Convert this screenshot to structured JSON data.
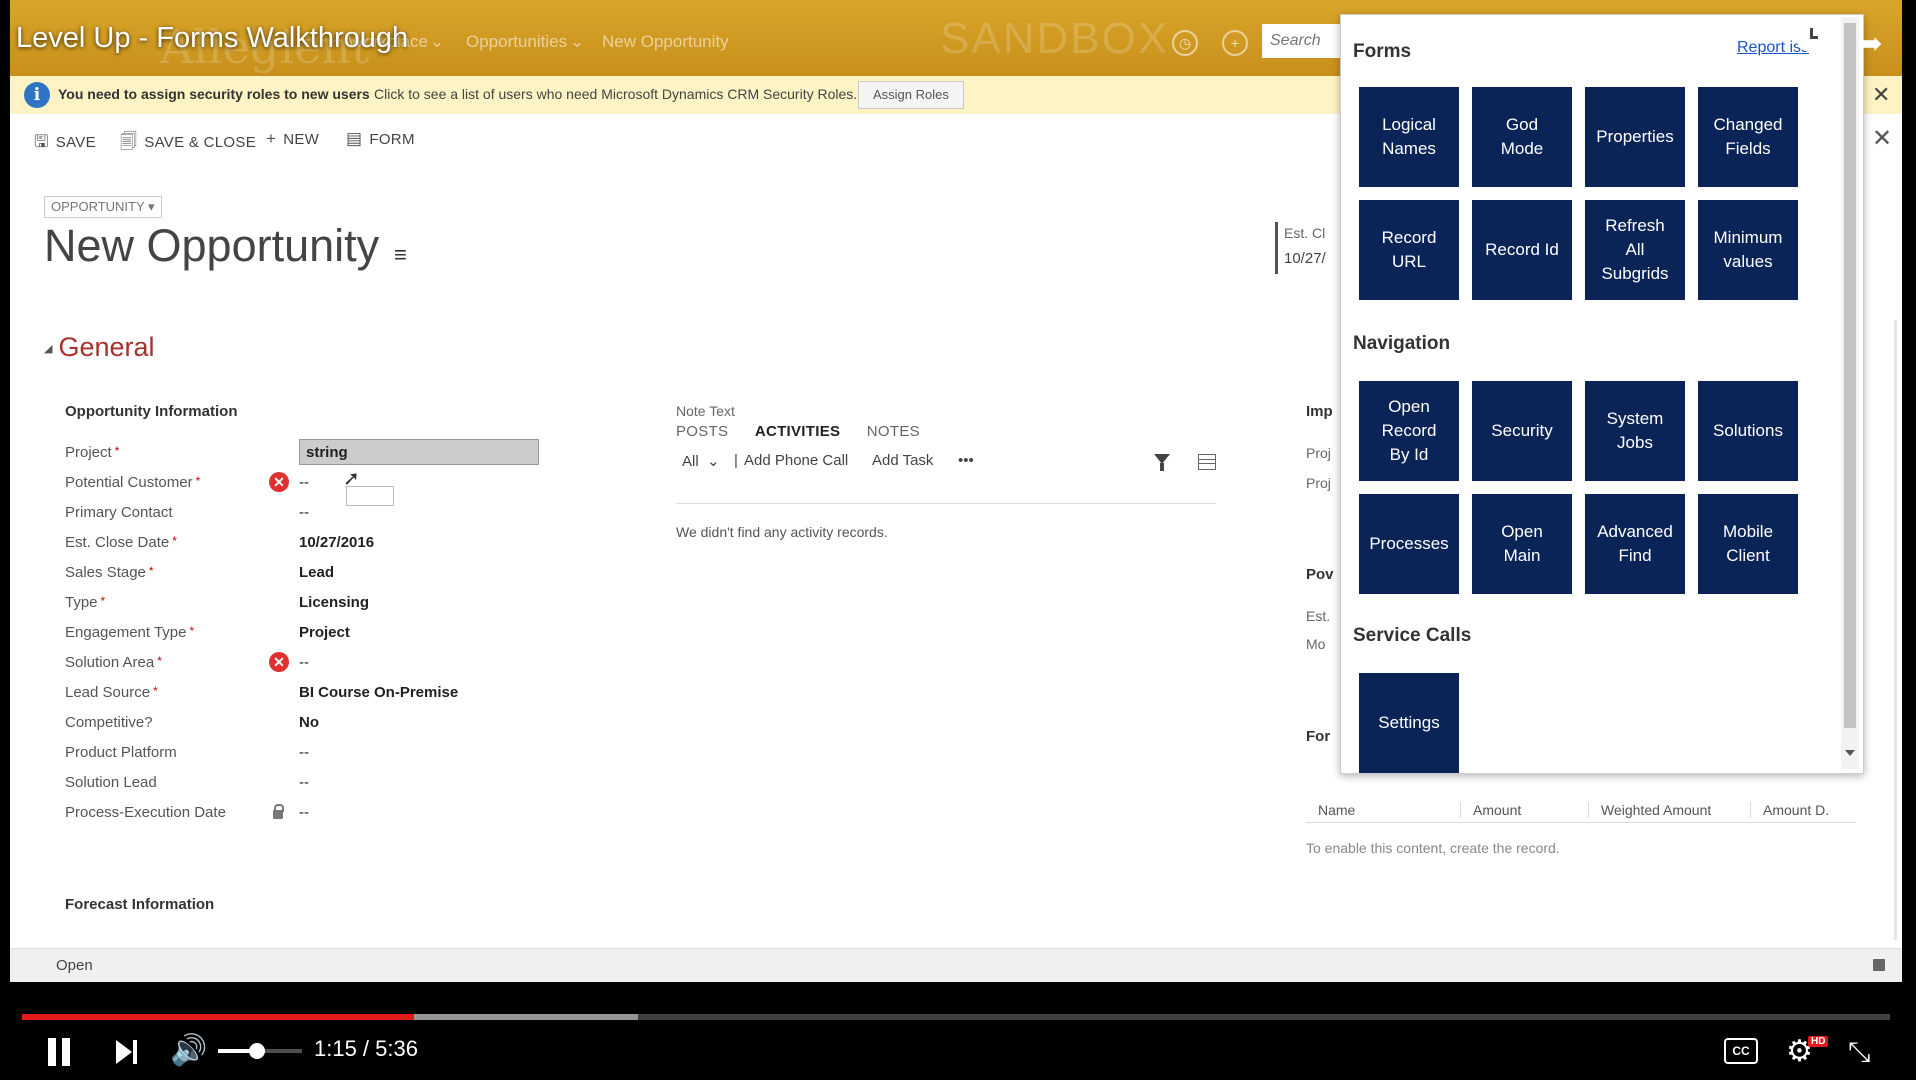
{
  "video": {
    "title": "Level Up - Forms Walkthrough",
    "time": "1:15 / 5:36",
    "progress_played": 0.21,
    "progress_buffered": 0.33,
    "volume": 0.47,
    "hd_badge": "HD",
    "cc_label": "CC"
  },
  "crm_nav": {
    "logo_text": "Allegient",
    "items": [
      "Workplace",
      "Opportunities",
      "New Opportunity"
    ],
    "sandbox": "SANDBOX",
    "search_placeholder": "Search"
  },
  "notification": {
    "bold": "You need to assign security roles to new users",
    "message": "Click to see a list of users who need Microsoft Dynamics CRM Security Roles.",
    "button": "Assign Roles"
  },
  "commands": [
    "SAVE",
    "SAVE & CLOSE",
    "NEW",
    "FORM"
  ],
  "header": {
    "entity_type": "OPPORTUNITY",
    "title": "New Opportunity",
    "field_label": "Est. Cl",
    "field_value": "10/27/"
  },
  "section": {
    "title": "General",
    "sub_heading": "Opportunity Information",
    "project_input": "string",
    "fields": [
      {
        "label": "Project",
        "value": ""
      },
      {
        "label": "Potential Customer",
        "value": "--"
      },
      {
        "label": "Primary Contact",
        "value": "--"
      },
      {
        "label": "Est. Close Date",
        "value": "10/27/2016"
      },
      {
        "label": "Sales Stage",
        "value": "Lead"
      },
      {
        "label": "Type",
        "value": "Licensing"
      },
      {
        "label": "Engagement Type",
        "value": "Project"
      },
      {
        "label": "Solution Area",
        "value": "--"
      },
      {
        "label": "Lead Source",
        "value": "BI Course On-Premise"
      },
      {
        "label": "Competitive?",
        "value": "No"
      },
      {
        "label": "Product Platform",
        "value": "--"
      },
      {
        "label": "Solution Lead",
        "value": "--"
      },
      {
        "label": "Process-Execution Date",
        "value": "--"
      }
    ],
    "forecast_heading": "Forecast Information"
  },
  "social": {
    "note_text": "Note Text",
    "tabs": [
      "POSTS",
      "ACTIVITIES",
      "NOTES"
    ],
    "filter": "All",
    "add_phone": "Add Phone Call",
    "add_task": "Add Task",
    "more": "•••",
    "empty": "We didn't find any activity records."
  },
  "right_col": {
    "imp": "Imp",
    "proj1": "Proj",
    "proj2": "Proj",
    "pov": "Pov",
    "est": "Est.",
    "mo": "Mo",
    "for": "For",
    "grid_headers": [
      "Name",
      "Amount",
      "Weighted Amount",
      "Amount D."
    ],
    "grid_note": "To enable this content, create the record."
  },
  "footer": {
    "status": "Open"
  },
  "popup": {
    "report": "Report iss",
    "forms_title": "Forms",
    "forms": [
      "Logical\nNames",
      "God\nMode",
      "Properties",
      "Changed\nFields",
      "Record\nURL",
      "Record Id",
      "Refresh\nAll\nSubgrids",
      "Minimum\nvalues"
    ],
    "nav_title": "Navigation",
    "navigation": [
      "Open\nRecord\nBy Id",
      "Security",
      "System\nJobs",
      "Solutions",
      "Processes",
      "Open\nMain",
      "Advanced\nFind",
      "Mobile\nClient"
    ],
    "service_title": "Service Calls",
    "service": [
      "Settings"
    ]
  }
}
